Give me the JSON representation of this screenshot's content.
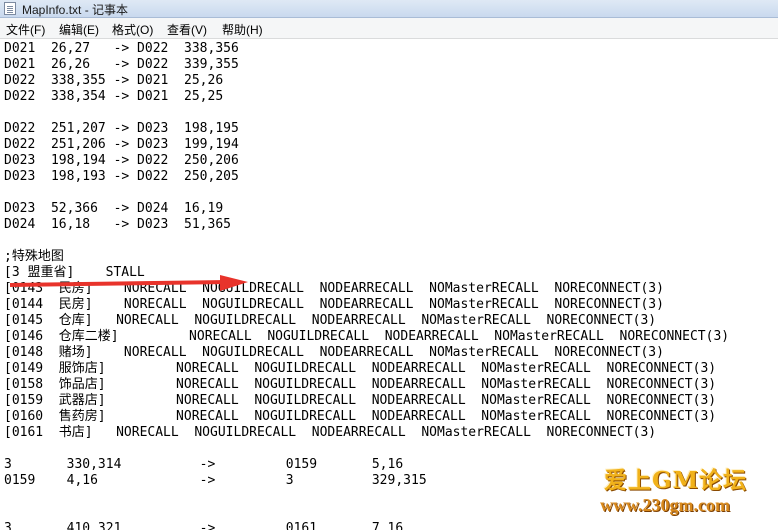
{
  "window": {
    "title": "MapInfo.txt - 记事本"
  },
  "menu": [
    "文件(F)",
    "编辑(E)",
    "格式(O)",
    "查看(V)",
    "帮助(H)"
  ],
  "lines": [
    "D021  26,27   -> D022  338,356",
    "D021  26,26   -> D022  339,355",
    "D022  338,355 -> D021  25,26",
    "D022  338,354 -> D021  25,25",
    "",
    "D022  251,207 -> D023  198,195",
    "D022  251,206 -> D023  199,194",
    "D023  198,194 -> D022  250,206",
    "D023  198,193 -> D022  250,205",
    "",
    "D023  52,366  -> D024  16,19",
    "D024  16,18   -> D023  51,365",
    "",
    ";特殊地图",
    "[3 盟重省]    STALL",
    "[0143  民房]    NORECALL  NOGUILDRECALL  NODEARRECALL  NOMasterRECALL  NORECONNECT(3)",
    "[0144  民房]    NORECALL  NOGUILDRECALL  NODEARRECALL  NOMasterRECALL  NORECONNECT(3)",
    "[0145  仓库]   NORECALL  NOGUILDRECALL  NODEARRECALL  NOMasterRECALL  NORECONNECT(3)",
    "[0146  仓库二楼]         NORECALL  NOGUILDRECALL  NODEARRECALL  NOMasterRECALL  NORECONNECT(3)",
    "[0148  赌场]    NORECALL  NOGUILDRECALL  NODEARRECALL  NOMasterRECALL  NORECONNECT(3)",
    "[0149  服饰店]         NORECALL  NOGUILDRECALL  NODEARRECALL  NOMasterRECALL  NORECONNECT(3)",
    "[0158  饰品店]         NORECALL  NOGUILDRECALL  NODEARRECALL  NOMasterRECALL  NORECONNECT(3)",
    "[0159  武器店]         NORECALL  NOGUILDRECALL  NODEARRECALL  NOMasterRECALL  NORECONNECT(3)",
    "[0160  售药房]         NORECALL  NOGUILDRECALL  NODEARRECALL  NOMasterRECALL  NORECONNECT(3)",
    "[0161  书店]   NORECALL  NOGUILDRECALL  NODEARRECALL  NOMasterRECALL  NORECONNECT(3)",
    "",
    "3       330,314          ->         0159       5,16",
    "0159    4,16             ->         3          329,315",
    "",
    "",
    "3       410,321          ->         0161       7,16"
  ],
  "watermark": {
    "title": "爱上GM论坛",
    "url": "www.230gm.com"
  },
  "colors": {
    "arrow": "#e8332b"
  }
}
